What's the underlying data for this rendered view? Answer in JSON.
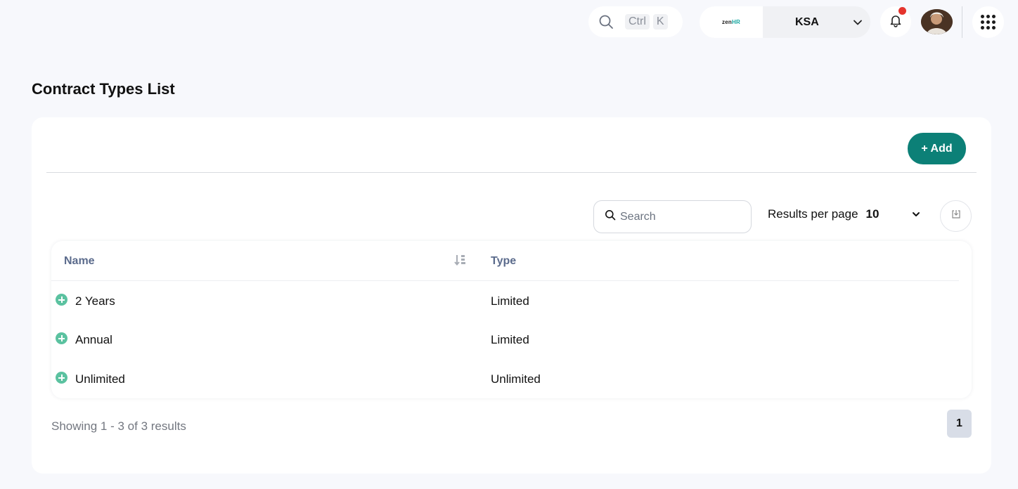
{
  "topbar": {
    "search_kbd": [
      "Ctrl",
      "K"
    ],
    "company_logo": "zenHR",
    "company_logo_parts": [
      "zen",
      "HR"
    ],
    "country": "KSA",
    "notification_badge_color": "#e5342d"
  },
  "page": {
    "title": "Contract Types List"
  },
  "toolbar": {
    "add_label": "+ Add",
    "accent_color": "#0c8077",
    "search_placeholder": "Search",
    "results_per_page_label": "Results per page",
    "results_per_page_value": "10"
  },
  "table": {
    "columns": [
      "Name",
      "Type"
    ],
    "rows": [
      {
        "name": "2 Years",
        "type": "Limited"
      },
      {
        "name": "Annual",
        "type": "Limited"
      },
      {
        "name": "Unlimited",
        "type": "Unlimited"
      }
    ]
  },
  "footer": {
    "showing": "Showing 1 - 3 of 3 results",
    "current_page": "1"
  }
}
